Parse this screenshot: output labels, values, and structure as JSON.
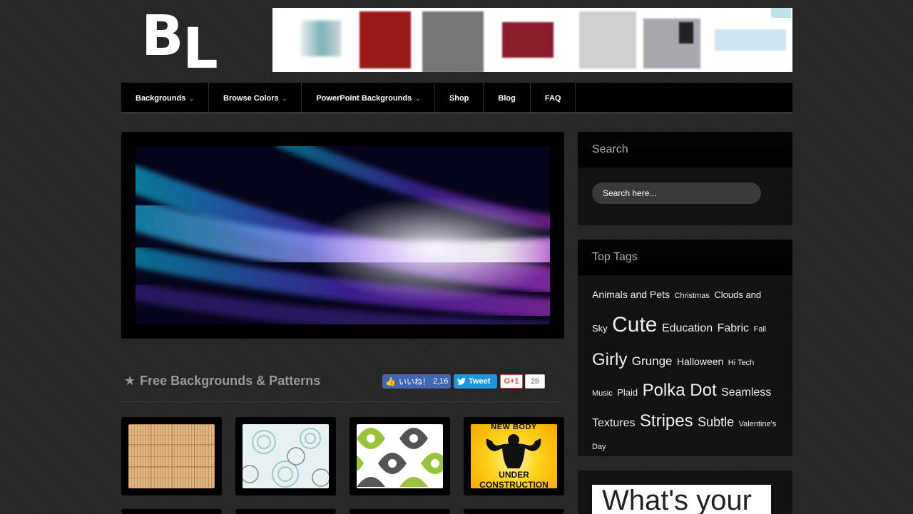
{
  "logo": {
    "letters": "BL",
    "first": "B",
    "second": "L"
  },
  "nav": {
    "items": [
      {
        "label": "Backgrounds",
        "dropdown": true
      },
      {
        "label": "Browse Colors",
        "dropdown": true
      },
      {
        "label": "PowerPoint Backgrounds",
        "dropdown": true
      },
      {
        "label": "Shop",
        "dropdown": false
      },
      {
        "label": "Blog",
        "dropdown": false
      },
      {
        "label": "FAQ",
        "dropdown": false
      }
    ],
    "chevron": "⌄"
  },
  "section": {
    "title": "Free Backgrounds & Patterns",
    "icon": "star-icon"
  },
  "social": {
    "facebook_label": "いいね！",
    "facebook_count": "2,16",
    "tweet_label": "Tweet",
    "gplus_label": "G+1",
    "gplus_count": "28"
  },
  "thumbnails": [
    {
      "name": "wood-weave"
    },
    {
      "name": "floral-blue"
    },
    {
      "name": "green-drops"
    },
    {
      "name": "under-construction",
      "text_top": "NEW BODY",
      "text_bottom": "UNDER",
      "text_bottom2": "CONSTRUCTION"
    }
  ],
  "sidebar": {
    "search": {
      "title": "Search",
      "placeholder": "Search here..."
    },
    "tags": {
      "title": "Top Tags",
      "items": [
        {
          "label": "Animals and Pets",
          "size": 14
        },
        {
          "label": "Christmas",
          "size": 11
        },
        {
          "label": "Clouds and Sky",
          "size": 13
        },
        {
          "label": "Cute",
          "size": 30
        },
        {
          "label": "Education",
          "size": 16
        },
        {
          "label": "Fabric",
          "size": 16
        },
        {
          "label": "Fall",
          "size": 11
        },
        {
          "label": "Girly",
          "size": 24
        },
        {
          "label": "Grunge",
          "size": 17
        },
        {
          "label": "Halloween",
          "size": 14
        },
        {
          "label": "Hi Tech",
          "size": 11
        },
        {
          "label": "Music",
          "size": 11
        },
        {
          "label": "Plaid",
          "size": 13
        },
        {
          "label": "Polka Dot",
          "size": 24
        },
        {
          "label": "Seamless",
          "size": 16
        },
        {
          "label": "Textures",
          "size": 16
        },
        {
          "label": "Stripes",
          "size": 24
        },
        {
          "label": "Subtle",
          "size": 18
        },
        {
          "label": "Valentine's Day",
          "size": 11
        }
      ]
    },
    "promo_text": "What's your"
  },
  "colors": {
    "background": "#262626",
    "nav_bg": "#000000",
    "widget_bg": "#121212",
    "facebook": "#4267b2",
    "twitter": "#1b95e0",
    "gplus": "#dd4b39"
  }
}
